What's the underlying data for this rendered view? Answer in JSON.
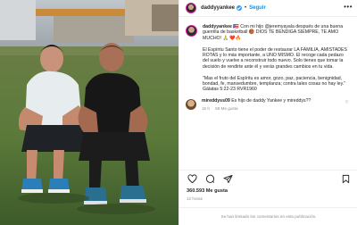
{
  "post": {
    "username": "daddyyankee",
    "dot": "•",
    "follow_label": "Seguir",
    "more_label": "•••"
  },
  "caption": {
    "username": "daddyyankee",
    "text": "🇵🇷 Con mi hijo @jeremyayala después de una buena guerrilla de basketball 🏀 DIOS TE BENDIGA SIEMPRE, TE AMO MUCHO! 🙏 ❤️🔥\n\nEl Espíritu Santo tiene el poder de restaurar LA FAMILIA, AMISTADES ROTAS y lo más importante, a UNO MISMO. El recoge cada pedazo del suelo y vuelve a reconstruir todo nuevo. Solo tienes que tomar la decisión de rendirte ante él y verás grandes cambios en tu vida.\n\n\"Mas el fruto del Espíritu es amor, gozo, paz, paciencia, benignidad, bondad, fe, mansedumbre, templanza; contra tales cosas no hay ley.\"\nGálatas 5:22-23 RVR1960"
  },
  "comment": {
    "username": "mireddyss09",
    "text": "Es hijo de daddy Yankee y mireddys??",
    "age": "15 h",
    "likes": "58 Me gusta"
  },
  "likes_text": "360.593 Me gusta",
  "date_text": "12 horas",
  "comments_limited_text": "Se han limitado los comentarios en esta publicación."
}
